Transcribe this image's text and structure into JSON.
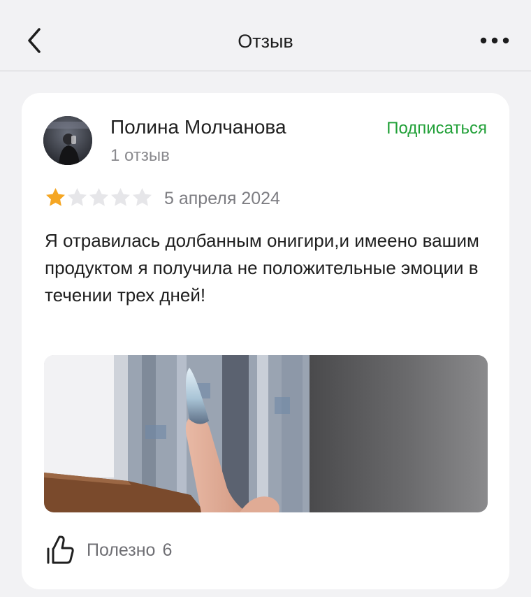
{
  "header": {
    "title": "Отзыв",
    "back_icon": "chevron-left-icon",
    "more_icon": "more-dots-icon"
  },
  "review": {
    "author_name": "Полина Молчанова",
    "author_review_count": "1 отзыв",
    "subscribe_label": "Подписаться",
    "rating": 1,
    "rating_max": 5,
    "date": "5 апреля 2024",
    "text": "Я отравилась долбанным онигири,и имеено вашим продуктом я получила не положительные эмоции в течении трех дней!",
    "helpful_label": "Полезно",
    "helpful_count": "6"
  },
  "colors": {
    "accent_green": "#21a038",
    "star_filled": "#f5a623",
    "star_empty": "#e6e6e9",
    "background": "#f2f2f4",
    "card": "#ffffff"
  }
}
